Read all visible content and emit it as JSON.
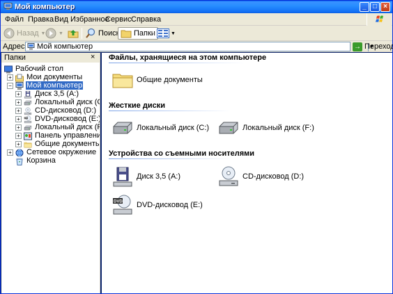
{
  "window": {
    "title": "Мой компьютер"
  },
  "menu": {
    "items": [
      {
        "label": "Файл"
      },
      {
        "label": "Правка"
      },
      {
        "label": "Вид"
      },
      {
        "label": "Избранное"
      },
      {
        "label": "Сервис"
      },
      {
        "label": "Справка"
      }
    ]
  },
  "toolbar": {
    "back_label": "Назад",
    "search_label": "Поиск",
    "folders_label": "Папки"
  },
  "address": {
    "label": "Адрес:",
    "value": "Мой компьютер",
    "go_label": "Переход"
  },
  "folders_pane": {
    "title": "Папки",
    "close_glyph": "×",
    "tree": [
      {
        "label": "Рабочий стол",
        "icon": "desktop-icon",
        "expander": ""
      },
      {
        "label": "Мои документы",
        "icon": "my-documents-icon",
        "expander": "+"
      },
      {
        "label": "Мой компьютер",
        "icon": "my-computer-icon",
        "expander": "−",
        "selected": true
      },
      {
        "label": "Диск 3,5 (A:)",
        "icon": "floppy-icon",
        "expander": "+"
      },
      {
        "label": "Локальный диск (C:)",
        "icon": "hard-disk-icon",
        "expander": "+"
      },
      {
        "label": "CD-дисковод (D:)",
        "icon": "cd-drive-icon",
        "expander": "+"
      },
      {
        "label": "DVD-дисковод (E:)",
        "icon": "dvd-drive-icon",
        "expander": "+"
      },
      {
        "label": "Локальный диск (F:)",
        "icon": "hard-disk-icon",
        "expander": "+"
      },
      {
        "label": "Панель управления",
        "icon": "control-panel-icon",
        "expander": "+"
      },
      {
        "label": "Общие документы",
        "icon": "folder-icon",
        "expander": "+"
      },
      {
        "label": "Сетевое окружение",
        "icon": "network-icon",
        "expander": "+"
      },
      {
        "label": "Корзина",
        "icon": "recycle-bin-icon",
        "expander": ""
      }
    ]
  },
  "content": {
    "groups": [
      {
        "title": "Файлы, хранящиеся на этом компьютере",
        "items": [
          {
            "label": "Общие документы",
            "icon": "folder-icon"
          }
        ]
      },
      {
        "title": "Жесткие диски",
        "items": [
          {
            "label": "Локальный диск (C:)",
            "icon": "hard-disk-icon"
          },
          {
            "label": "Локальный диск (F:)",
            "icon": "hard-disk-icon"
          }
        ]
      },
      {
        "title": "Устройства со съемными носителями",
        "items": [
          {
            "label": "Диск 3,5 (A:)",
            "icon": "floppy-icon"
          },
          {
            "label": "CD-дисковод (D:)",
            "icon": "cd-drive-icon"
          },
          {
            "label": "DVD-дисковод (E:)",
            "icon": "dvd-drive-icon"
          }
        ]
      }
    ]
  },
  "colors": {
    "titlebar": "#0058ee",
    "selection": "#316ac5",
    "chrome": "#ece9d8"
  }
}
